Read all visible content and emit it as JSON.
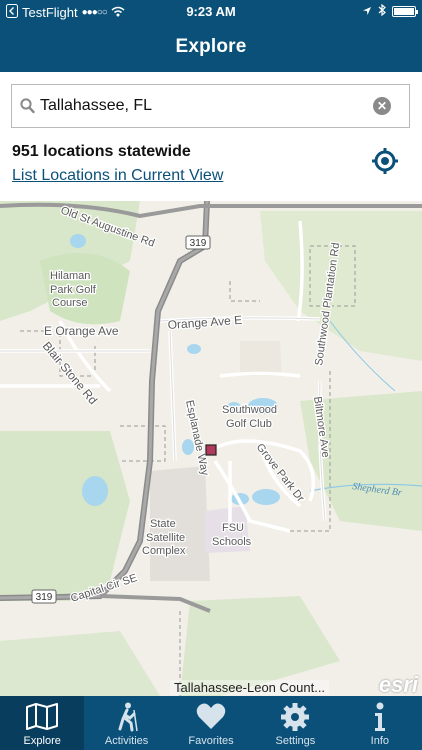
{
  "status_bar": {
    "carrier": "TestFlight",
    "signal": "●●●○○",
    "time": "9:23 AM"
  },
  "nav": {
    "title": "Explore"
  },
  "search": {
    "value": "Tallahassee, FL",
    "placeholder": ""
  },
  "results": {
    "count_text": "951 locations statewide",
    "list_link": "List Locations in Current View"
  },
  "map": {
    "labels": {
      "old_st_augustine": "Old St Augustine Rd",
      "hilaman": "Hilaman",
      "park_golf": "Park Golf",
      "course": "Course",
      "e_orange": "E Orange Ave",
      "orange_e": "Orange Ave E",
      "blair_stone": "Blair Stone Rd",
      "southwood_plantation": "Southwood Plantation Rd",
      "southwood": "Southwood",
      "golf_club": "Golf Club",
      "esplanade": "Esplanade Way",
      "grove_park": "Grove Park Dr",
      "biltmore": "Biltmore Ave",
      "shepherd": "Shepherd Br",
      "state": "State",
      "satellite": "Satellite",
      "complex": "Complex",
      "fsu": "FSU",
      "schools": "Schools",
      "capital_cir": "Capital Cir SE",
      "r319a": "319",
      "r319b": "319"
    },
    "attribution": "Tallahassee-Leon Count...",
    "logo": "esri"
  },
  "tabs": [
    {
      "label": "Explore",
      "icon": "map-icon"
    },
    {
      "label": "Activities",
      "icon": "hiker-icon"
    },
    {
      "label": "Favorites",
      "icon": "heart-icon"
    },
    {
      "label": "Settings",
      "icon": "gear-icon"
    },
    {
      "label": "Info",
      "icon": "info-icon"
    }
  ],
  "colors": {
    "primary": "#0b5079",
    "marker": "#b03a5b"
  }
}
